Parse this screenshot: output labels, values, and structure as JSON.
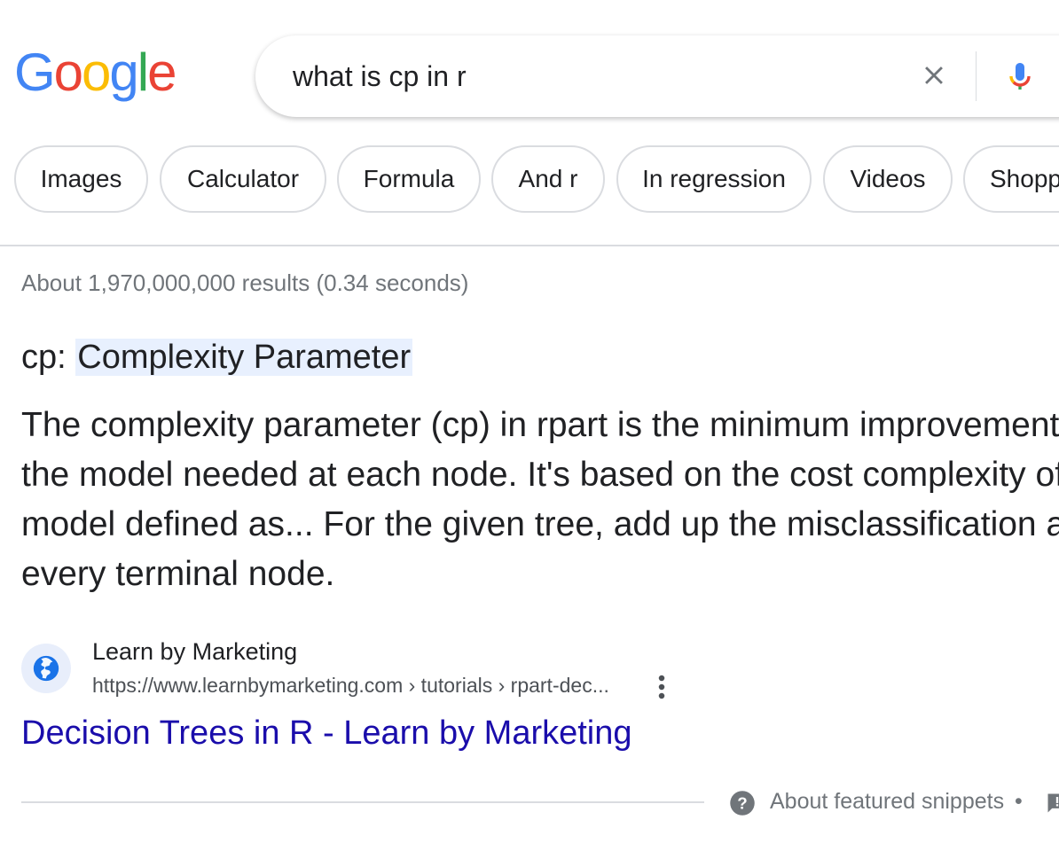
{
  "logo": {
    "letters": [
      "G",
      "o",
      "o",
      "g",
      "l",
      "e"
    ],
    "colors": [
      "#4285F4",
      "#EA4335",
      "#FBBC05",
      "#4285F4",
      "#34A853",
      "#EA4335"
    ]
  },
  "search": {
    "query": "what is cp in r"
  },
  "chips": [
    "Images",
    "Calculator",
    "Formula",
    "And r",
    "In regression",
    "Videos",
    "Shopping"
  ],
  "result_stats": "About 1,970,000,000 results (0.34 seconds)",
  "featured_snippet": {
    "heading_prefix": "cp: ",
    "heading_highlight": "Complexity Parameter",
    "body_lines": [
      "The complexity parameter (cp) in rpart is the minimum improvement in",
      "the model needed at each node. It's based on the cost complexity of the",
      "model defined as... For the given tree, add up the misclassification at",
      "every terminal node."
    ],
    "source_name": "Learn by Marketing",
    "source_url": "https://www.learnbymarketing.com › tutorials › rpart-dec...",
    "link_title": "Decision Trees in R - Learn by Marketing"
  },
  "footer": {
    "about_snippets": "About featured snippets",
    "separator": "•"
  },
  "colors": {
    "link": "#1a0dab",
    "highlight": "#e8f0fe",
    "muted": "#70757a",
    "border": "#dadce0"
  }
}
